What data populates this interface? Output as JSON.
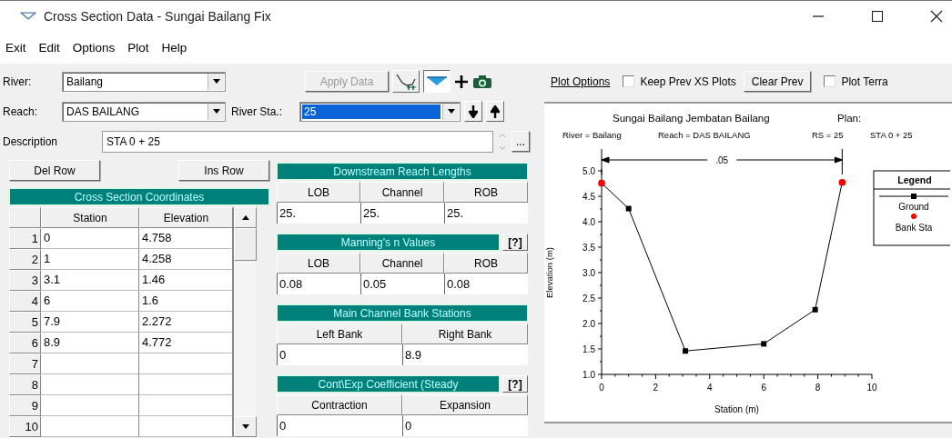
{
  "window": {
    "title": "Cross Section Data - Sungai Bailang Fix"
  },
  "menu": [
    "Exit",
    "Edit",
    "Options",
    "Plot",
    "Help"
  ],
  "river": {
    "label": "River:",
    "value": "Bailang"
  },
  "apply_button": {
    "label": "Apply Data",
    "disabled": true
  },
  "reach": {
    "label": "Reach:",
    "value": "DAS BAILANG"
  },
  "river_station": {
    "label": "River Sta.:",
    "value": "25",
    "focused": true
  },
  "description": {
    "label": "Description",
    "value": "STA 0 + 25",
    "more_button": "..."
  },
  "row_buttons": [
    "Del Row",
    "Ins Row"
  ],
  "coordinates": {
    "title": "Cross Section Coordinates",
    "columns": [
      "Station",
      "Elevation"
    ],
    "rows": [
      {
        "number": "1",
        "station": "0",
        "elevation": "4.758"
      },
      {
        "number": "2",
        "station": "1",
        "elevation": "4.258"
      },
      {
        "number": "3",
        "station": "3.1",
        "elevation": "1.46"
      },
      {
        "number": "4",
        "station": "6",
        "elevation": "1.6"
      },
      {
        "number": "5",
        "station": "7.9",
        "elevation": "2.272"
      },
      {
        "number": "6",
        "station": "8.9",
        "elevation": "4.772"
      },
      {
        "number": "7"
      },
      {
        "number": "8"
      },
      {
        "number": "9"
      },
      {
        "number": "10"
      }
    ]
  },
  "panels": [
    {
      "title": "Downstream Reach Lengths",
      "columns": [
        "LOB",
        "Channel",
        "ROB"
      ],
      "values": [
        "25.",
        "25.",
        "25."
      ]
    },
    {
      "title": "Manning's n Values",
      "help": "[?]",
      "columns": [
        "LOB",
        "Channel",
        "ROB"
      ],
      "values": [
        "0.08",
        "0.05",
        "0.08"
      ]
    },
    {
      "title": "Main Channel Bank Stations",
      "columns": [
        "Left Bank",
        "Right Bank"
      ],
      "values": [
        "0",
        "8.9"
      ]
    },
    {
      "title": "Cont\\Exp Coefficient (Steady",
      "help": "[?]",
      "columns": [
        "Contraction",
        "Expansion"
      ],
      "values": [
        "0",
        "0"
      ]
    }
  ],
  "plot_toolbar": {
    "options_link": "Plot Options",
    "keep_prev": {
      "label": "Keep Prev XS Plots",
      "checked": false
    },
    "clear_button": "Clear Prev",
    "plot_terrain": {
      "label": "Plot Terra",
      "checked": false
    }
  },
  "plot": {
    "title": "Sungai Bailang Jembatan Bailang",
    "plan": "Plan:",
    "subtitle": [
      "River = Bailang",
      "Reach = DAS BAILANG",
      "RS = 25",
      "STA 0 + 25"
    ],
    "legend_title": "Legend",
    "bank_marker": {
      "label": "Bank Sta",
      "color": "#ff0000"
    },
    "chart_data": {
      "type": "line",
      "xlabel": "Station (m)",
      "ylabel": "Elevation (m)",
      "x": [
        0,
        1,
        3.1,
        6,
        7.9,
        8.9
      ],
      "series": [
        {
          "name": "Ground",
          "color": "#000000",
          "marker": "square",
          "values": [
            4.758,
            4.258,
            1.46,
            1.6,
            2.272,
            4.772
          ]
        }
      ],
      "xlim": [
        0,
        10
      ],
      "ylim": [
        1,
        5
      ],
      "xticks": [
        0,
        2,
        4,
        6,
        8,
        10
      ],
      "yticks": [
        {
          "value": 1,
          "label": "1.0"
        },
        {
          "value": 1.5,
          "label": "1.5"
        },
        {
          "value": 2,
          "label": "2.0"
        },
        {
          "value": 2.5,
          "label": "2.5"
        },
        {
          "value": 3,
          "label": "3.0"
        },
        {
          "value": 3.5,
          "label": "3.5"
        },
        {
          "value": 4,
          "label": "4.0"
        },
        {
          "value": 4.5,
          "label": "4.5"
        },
        {
          "value": 5,
          "label": "5.0"
        }
      ],
      "annotations": [
        ".05"
      ]
    }
  }
}
